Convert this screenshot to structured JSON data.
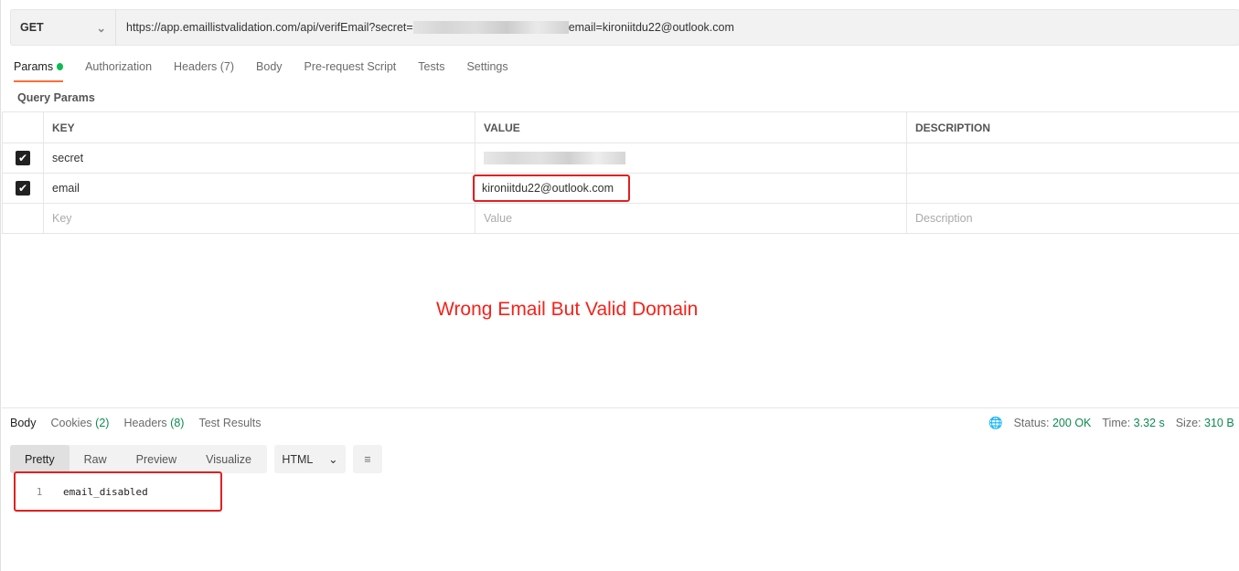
{
  "request": {
    "method": "GET",
    "url_prefix": "https://app.emaillistvalidation.com/api/verifEmail?secret=",
    "url_suffix": "email=kironiitdu22@outlook.com"
  },
  "tabs": [
    {
      "label": "Params"
    },
    {
      "label": "Authorization"
    },
    {
      "label": "Headers (7)"
    },
    {
      "label": "Body"
    },
    {
      "label": "Pre-request Script"
    },
    {
      "label": "Tests"
    },
    {
      "label": "Settings"
    }
  ],
  "query_params_label": "Query Params",
  "table": {
    "headers": [
      "KEY",
      "VALUE",
      "DESCRIPTION"
    ],
    "rows": [
      {
        "checked": true,
        "key": "secret",
        "value": "",
        "description": ""
      },
      {
        "checked": true,
        "key": "email",
        "value": "kironiitdu22@outlook.com",
        "description": ""
      }
    ],
    "placeholders": {
      "key": "Key",
      "value": "Value",
      "description": "Description"
    }
  },
  "annotation": "Wrong Email But Valid Domain",
  "response": {
    "tabs": [
      {
        "label": "Body"
      },
      {
        "label": "Cookies",
        "count": "(2)"
      },
      {
        "label": "Headers",
        "count": "(8)"
      },
      {
        "label": "Test Results"
      }
    ],
    "status_label": "Status:",
    "status": "200 OK",
    "time_label": "Time:",
    "time": "3.32 s",
    "size_label": "Size:",
    "size": "310 B",
    "views": [
      "Pretty",
      "Raw",
      "Preview",
      "Visualize"
    ],
    "format": "HTML",
    "line_number": "1",
    "body": "email_disabled"
  }
}
